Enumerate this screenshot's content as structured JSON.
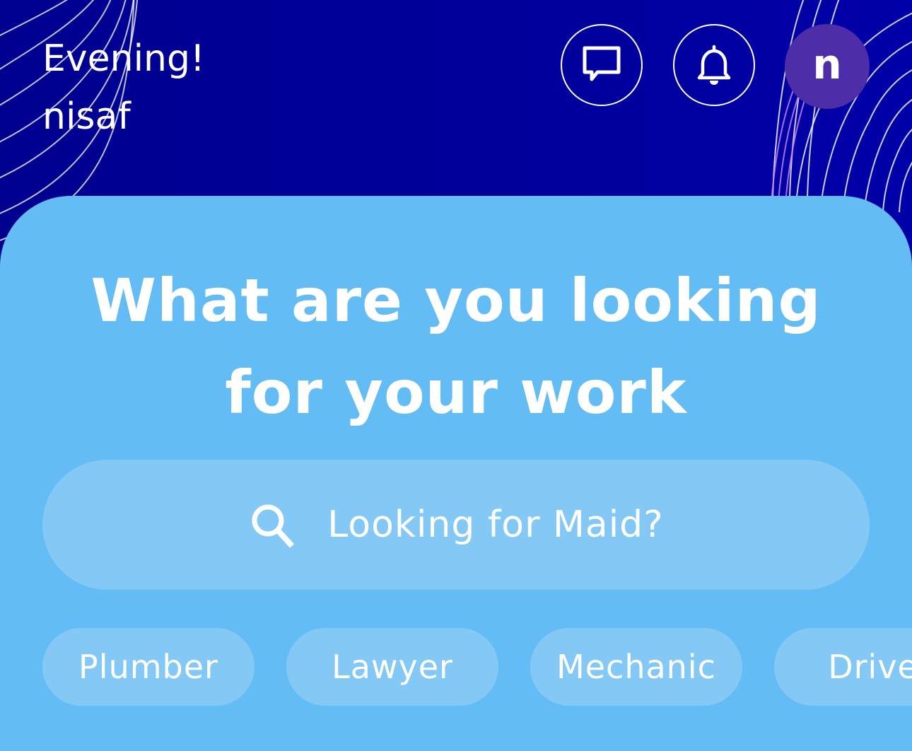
{
  "header": {
    "greeting": "Evening!",
    "username": "nisaf",
    "avatar_initial": "n",
    "chat_icon": "chat-bubble-icon",
    "notification_icon": "bell-icon"
  },
  "main": {
    "headline_line1": "What are you looking",
    "headline_line2": "for your work"
  },
  "search": {
    "placeholder": "Looking for Maid?",
    "icon": "search-icon"
  },
  "categories": [
    {
      "label": "Plumber"
    },
    {
      "label": "Lawyer"
    },
    {
      "label": "Mechanic"
    },
    {
      "label": "Driver"
    }
  ],
  "colors": {
    "header_background": "#000099",
    "card_background": "#63bcf4",
    "chip_background": "#84c9f6",
    "avatar_background": "#4e2ea8"
  }
}
